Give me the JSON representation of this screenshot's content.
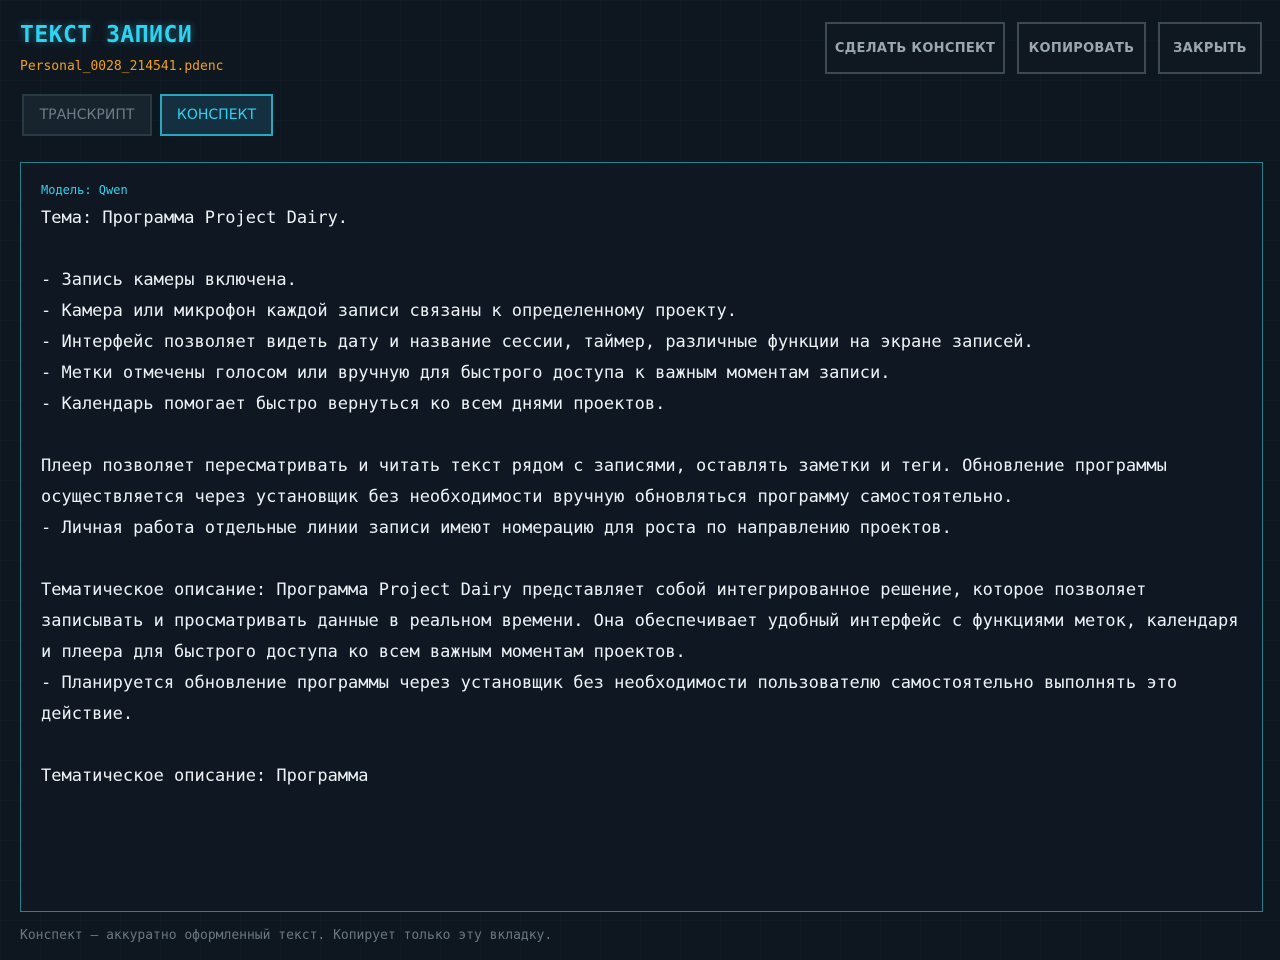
{
  "header": {
    "title": "ТЕКСТ ЗАПИСИ",
    "filename": "Personal_0028_214541.pdenc"
  },
  "toolbar": {
    "summarize_label": "СДЕЛАТЬ КОНСПЕКТ",
    "copy_label": "КОПИРОВАТЬ",
    "close_label": "ЗАКРЫТЬ"
  },
  "tabs": [
    {
      "label": "ТРАНСКРИПТ",
      "active": false
    },
    {
      "label": "КОНСПЕКТ",
      "active": true
    }
  ],
  "content": {
    "model_label": "Модель: Qwen",
    "text": "Тема: Программа Project Dairy.\n\n- Запись камеры включена.\n- Камера или микрофон каждой записи связаны к определенному проекту.\n- Интерфейс позволяет видеть дату и название сессии, таймер, различные функции на экране записей.\n- Метки отмечены голосом или вручную для быстрого доступа к важным моментам записи.\n- Календарь помогает быстро вернуться ко всем днями проектов.\n\nПлеер позволяет пересматривать и читать текст рядом с записями, оставлять заметки и теги. Обновление программы осуществляется через установщик без необходимости вручную обновляться программу самостоятельно.\n- Личная работа отдельные линии записи имеют номерацию для роста по направлению проектов.\n\nТематическое описание: Программа Project Dairy представляет собой интегрированное решение, которое позволяет записывать и просматривать данные в реальном времени. Она обеспечивает удобный интерфейс с функциями меток, календаря и плеера для быстрого доступа ко всем важным моментам проектов.\n- Планируется обновление программы через установщик без необходимости пользователю самостоятельно выполнять это действие.\n\nТематическое описание: Программа"
  },
  "footer": {
    "hint": "Конспект — аккуратно оформленный текст. Копирует только эту вкладку."
  },
  "colors": {
    "accent": "#2fd3ef",
    "filename": "#f0a020",
    "background": "#0e1620",
    "panel_border": "#2a7f8e"
  }
}
